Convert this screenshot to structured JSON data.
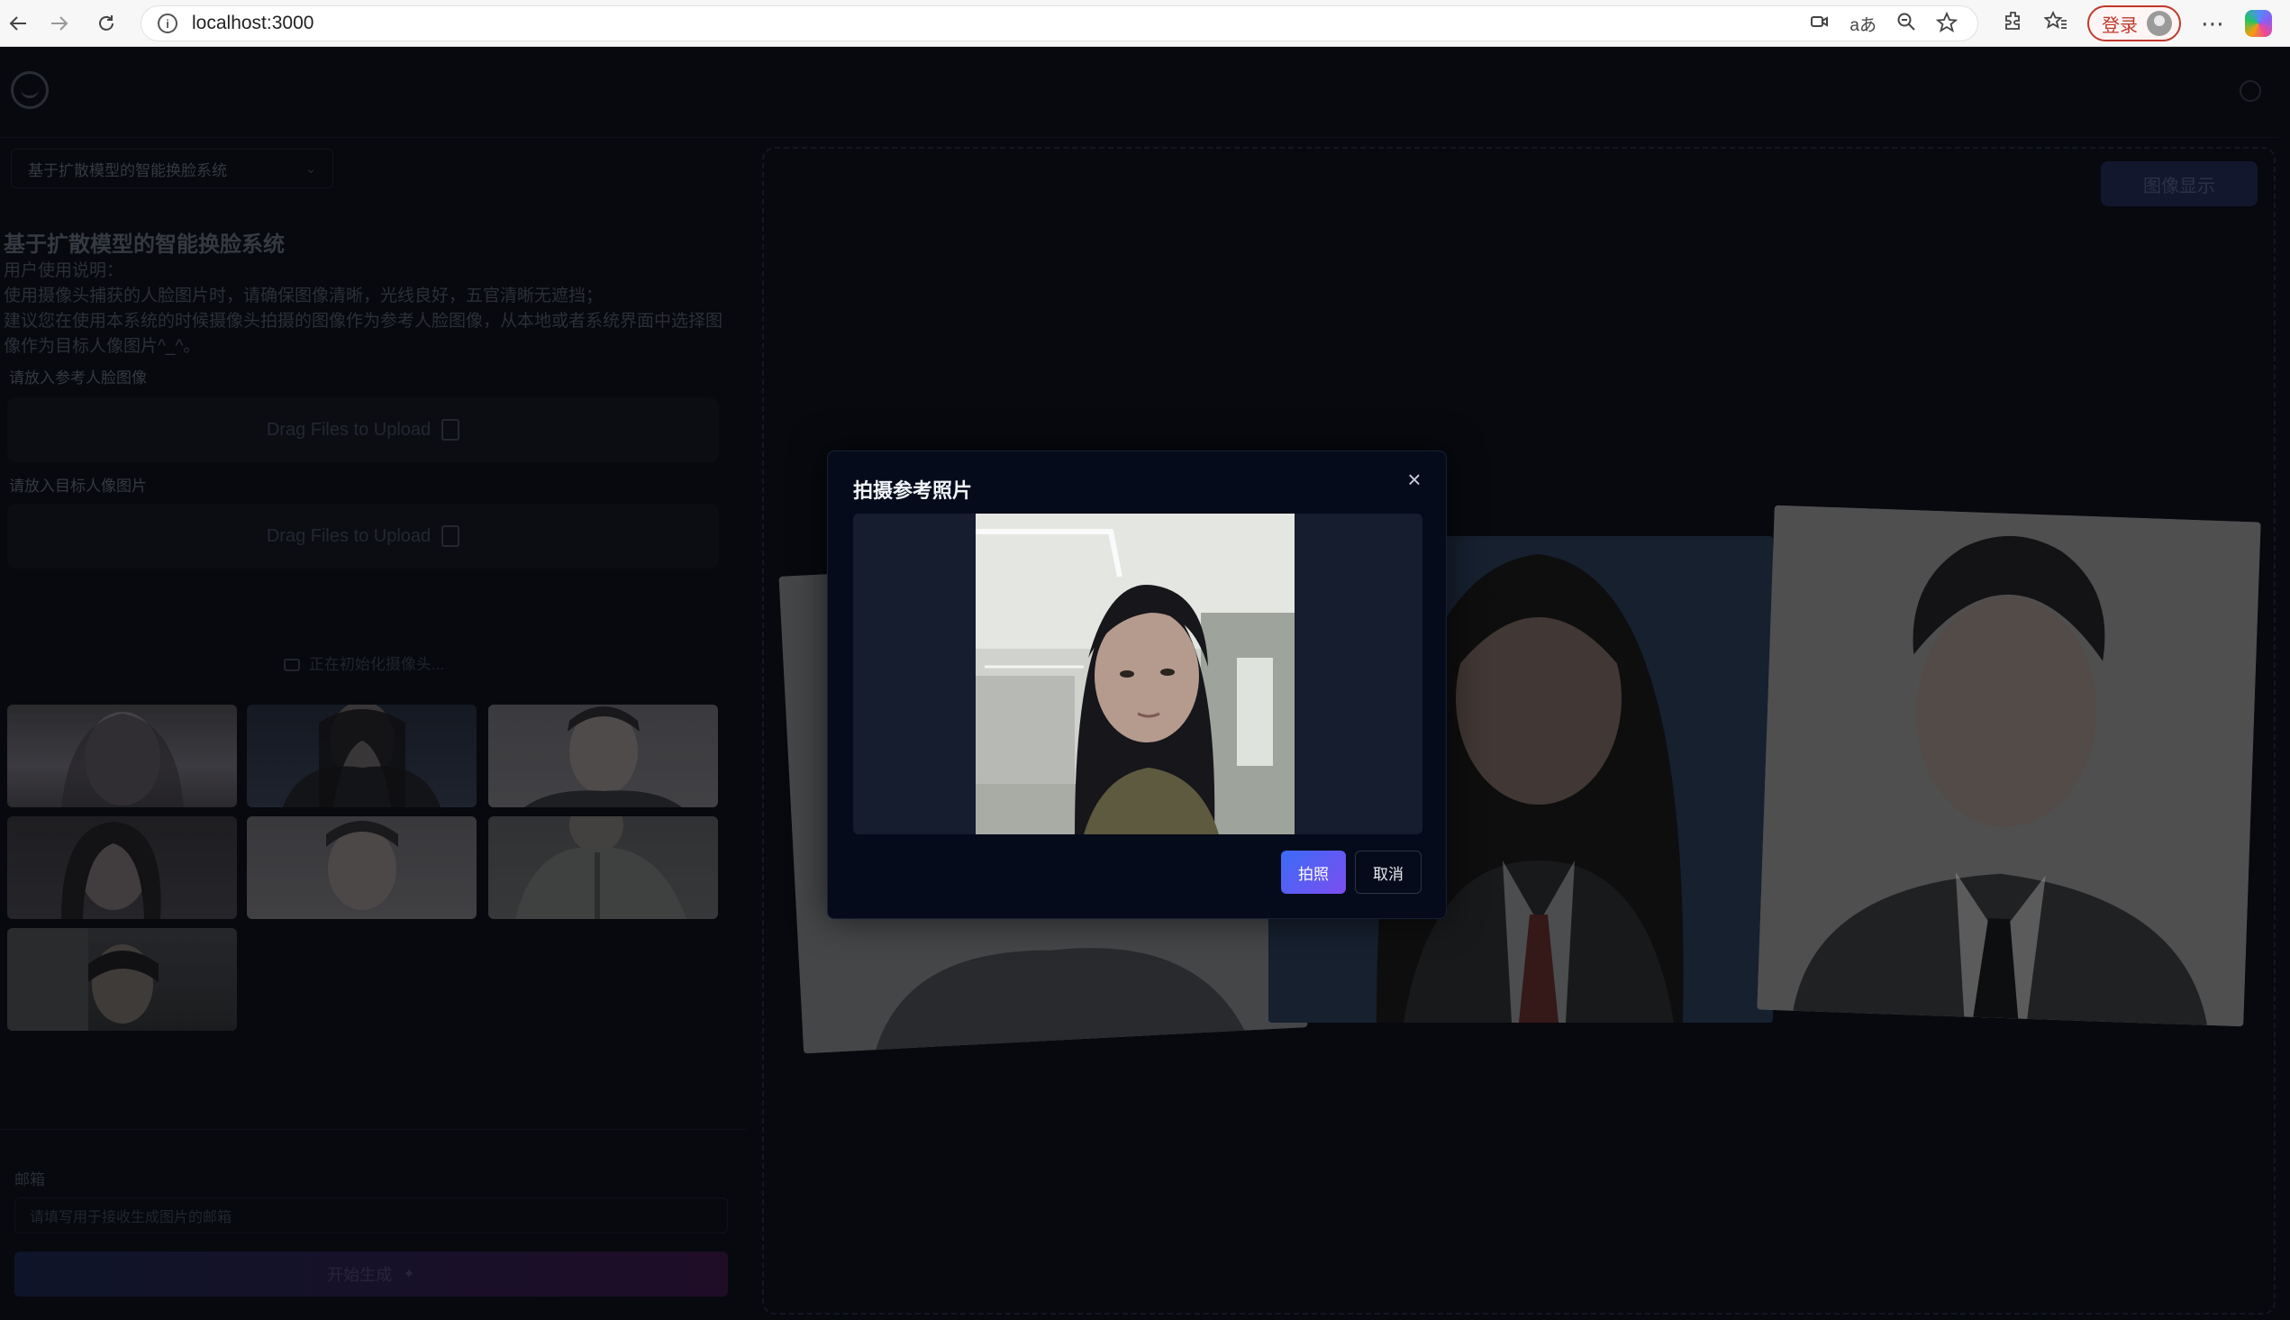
{
  "browser": {
    "url": "localhost:3000",
    "login_label": "登录"
  },
  "app": {
    "select_value": "基于扩散模型的智能换脸系统",
    "title": "基于扩散模型的智能换脸系统",
    "instructions": [
      "用户使用说明：",
      "使用摄像头捕获的人脸图片时，请确保图像清晰，光线良好，五官清晰无遮挡；",
      "建议您在使用本系统的时候摄像头拍摄的图像作为参考人脸图像，从本地或者系统界面中选择图像作为目标人像图片^_^。"
    ],
    "reference_label": "请放入参考人脸图像",
    "target_label": "请放入目标人像图片",
    "upload_text": "Drag Files to Upload",
    "camera_status": "正在初始化摄像头...",
    "email_label": "邮箱",
    "email_placeholder": "请填写用于接收生成图片的邮箱",
    "generate_label": "开始生成",
    "display_button": "图像显示"
  },
  "modal": {
    "title": "拍摄参考照片",
    "capture_label": "拍照",
    "cancel_label": "取消"
  },
  "colors": {
    "accent_gradient_start": "#3b6cf6",
    "accent_gradient_end": "#7c4df0",
    "app_background": "#0b0d14",
    "modal_background": "#050b1a"
  },
  "icons": {
    "back": "arrow-left-icon",
    "forward": "arrow-right-icon",
    "reload": "reload-icon",
    "close": "close-icon",
    "camera": "camera-icon",
    "upload": "file-upload-icon",
    "magic": "magic-wand-icon"
  }
}
